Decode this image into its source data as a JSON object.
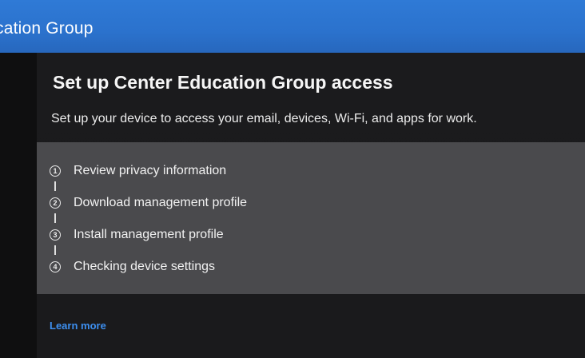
{
  "window": {
    "title": "cation Group"
  },
  "dialog": {
    "heading": "Set up Center Education Group access",
    "subtitle": "Set up your device to access your email, devices, Wi-Fi, and apps for work.",
    "steps": [
      {
        "number": "1",
        "label": "Review privacy information"
      },
      {
        "number": "2",
        "label": "Download management profile"
      },
      {
        "number": "3",
        "label": "Install management profile"
      },
      {
        "number": "4",
        "label": "Checking device settings"
      }
    ],
    "learn_more": "Learn more"
  },
  "colors": {
    "title_bar": "#2f7ad6",
    "background": "#1b1b1d",
    "steps_panel": "#4a4a4d",
    "link": "#3d8ff0"
  }
}
